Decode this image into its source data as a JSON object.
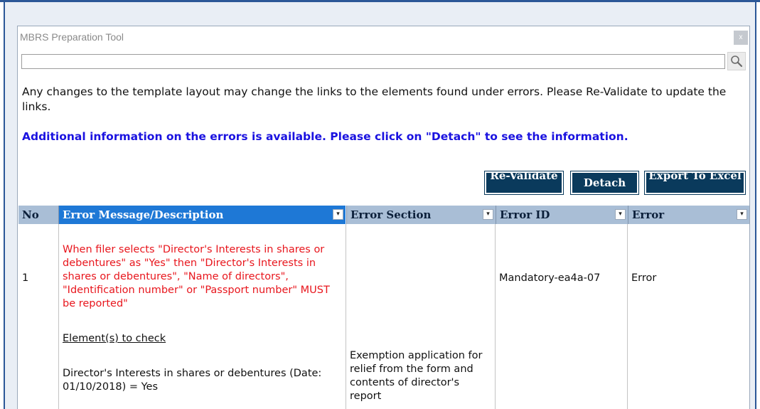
{
  "window": {
    "title": "MBRS Preparation Tool",
    "close_label": "x"
  },
  "search": {
    "value": "",
    "placeholder": ""
  },
  "info": {
    "layout_warning": "Any changes to the template layout may change the links to the elements found under errors. Please Re-Validate to update the links.",
    "detach_hint": "Additional information on the errors is available. Please click on \"Detach\" to see the information."
  },
  "buttons": {
    "revalidate": "Re-Validate",
    "detach": "Detach",
    "export": "Export To Excel"
  },
  "table": {
    "filter_glyph": "▾",
    "columns": {
      "no": "No",
      "message": "Error Message/Description",
      "section": "Error Section",
      "error_id": "Error ID",
      "error": "Error"
    },
    "rows": [
      {
        "no": "1",
        "message": "When filer selects \"Director's Interests in shares or debentures\" as \"Yes\" then \"Director's Interests in shares or debentures\", \"Name of directors\", \"Identification number\" or \"Passport number\" MUST be reported\"",
        "check_label": "Element(s) to check",
        "check_detail": "Director's Interests in shares or debentures (Date: 01/10/2018) = Yes",
        "section": "Exemption application for relief from the form and contents of director's report",
        "error_id": "Mandatory-ea4a-07",
        "error": "Error"
      }
    ]
  },
  "colors": {
    "accent": "#2b5797",
    "header_active": "#1e78d6",
    "header": "#a9bed6",
    "button": "#0a3a5c",
    "error_text": "#e8161d",
    "info_link": "#1a12e0"
  }
}
